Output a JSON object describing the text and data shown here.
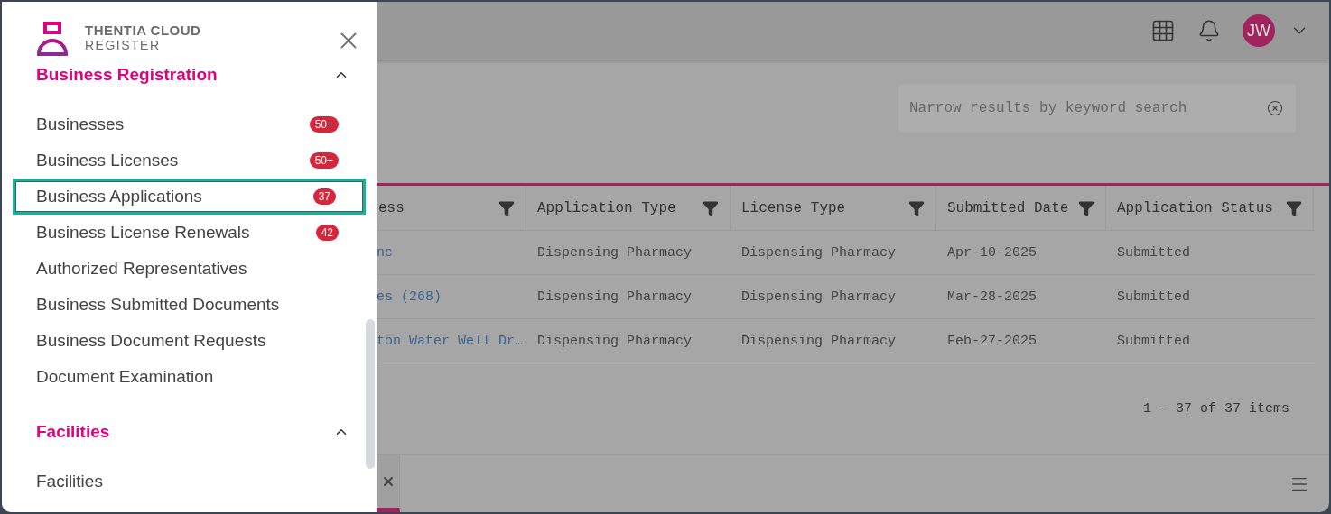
{
  "brand": {
    "line1": "THENTIA CLOUD",
    "line2": "REGISTER"
  },
  "nav": [
    {
      "title": "Business Registration",
      "expanded": true,
      "items": [
        {
          "label": "Businesses",
          "badge": "50+",
          "highlighted": false
        },
        {
          "label": "Business Licenses",
          "badge": "50+",
          "highlighted": false
        },
        {
          "label": "Business Applications",
          "badge": "37",
          "highlighted": true
        },
        {
          "label": "Business License Renewals",
          "badge": "42",
          "highlighted": false
        },
        {
          "label": "Authorized Representatives",
          "highlighted": false
        },
        {
          "label": "Business Submitted Documents",
          "highlighted": false
        },
        {
          "label": "Business Document Requests",
          "highlighted": false
        },
        {
          "label": "Document Examination",
          "highlighted": false
        }
      ]
    },
    {
      "title": "Facilities",
      "expanded": true,
      "items": [
        {
          "label": "Facilities",
          "highlighted": false
        }
      ]
    }
  ],
  "header": {
    "avatar": "JW"
  },
  "search": {
    "placeholder": "Narrow results by keyword search"
  },
  "table": {
    "columns": [
      "ess",
      "Application Type",
      "License Type",
      "Submitted Date",
      "Application Status"
    ],
    "rows": [
      [
        "nc",
        "Dispensing Pharmacy",
        "Dispensing Pharmacy",
        "Apr-10-2025",
        "Submitted"
      ],
      [
        "es (268)",
        "Dispensing Pharmacy",
        "Dispensing Pharmacy",
        "Mar-28-2025",
        "Submitted"
      ],
      [
        "ton Water Well Dr…",
        "Dispensing Pharmacy",
        "Dispensing Pharmacy",
        "Feb-27-2025",
        "Submitted"
      ]
    ]
  },
  "pagination": "1 - 37 of 37 items"
}
